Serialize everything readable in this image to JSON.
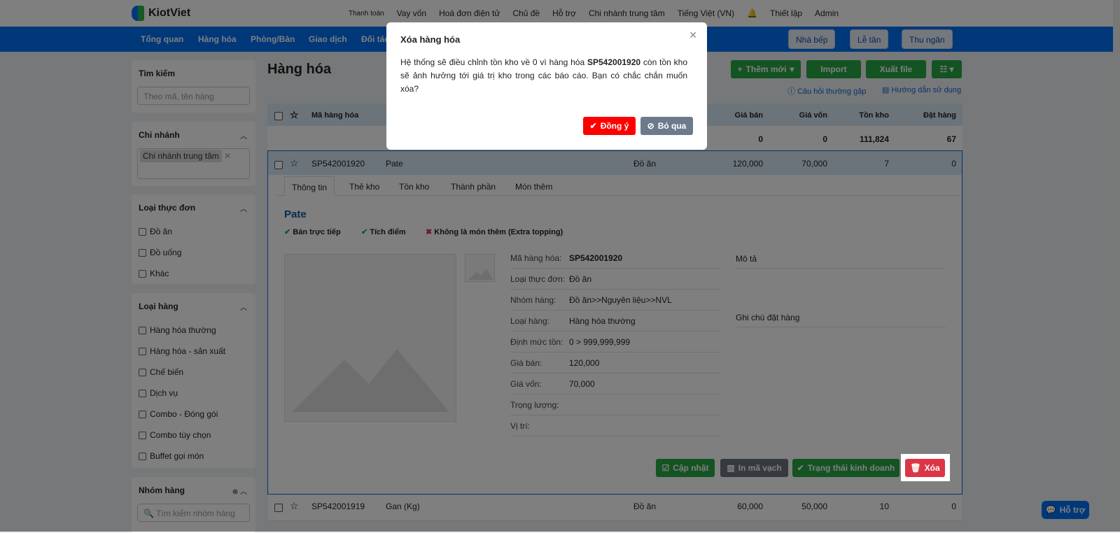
{
  "header": {
    "logo": "KiotViet",
    "links": [
      "Thanh toán",
      "Vay vốn",
      "Hoá đơn điện tử",
      "Chủ đề",
      "Hỗ trợ",
      "Chi nhánh trung tâm",
      "Tiếng Việt (VN)",
      "Thiết lập",
      "Admin"
    ]
  },
  "nav": {
    "items": [
      "Tổng quan",
      "Hàng hóa",
      "Phòng/Bàn",
      "Giao dịch",
      "Đối tác"
    ],
    "buttons": [
      "Nhà bếp",
      "Lễ tân",
      "Thu ngân"
    ]
  },
  "sidebar": {
    "search": {
      "title": "Tìm kiếm",
      "placeholder": "Theo mã, tên hàng"
    },
    "branch": {
      "title": "Chi nhánh",
      "tag": "Chi nhánh trung tâm"
    },
    "menu_type": {
      "title": "Loại thực đơn",
      "items": [
        "Đồ ăn",
        "Đồ uống",
        "Khác"
      ]
    },
    "goods_type": {
      "title": "Loại hàng",
      "items": [
        "Hàng hóa thường",
        "Hàng hóa - sản xuất",
        "Chế biến",
        "Dịch vụ",
        "Combo - Đóng gói",
        "Combo tùy chọn",
        "Buffet gọi món"
      ]
    },
    "group": {
      "title": "Nhóm hàng",
      "placeholder": "Tìm kiếm nhóm hàng"
    }
  },
  "main": {
    "title": "Hàng hóa",
    "actions": [
      "Thêm mới",
      "Import",
      "Xuất file"
    ],
    "help": [
      "Câu hỏi thường gặp",
      "Hướng dẫn sử dụng"
    ],
    "columns": [
      "Mã hàng hóa",
      "Giá bán",
      "Giá vốn",
      "Tồn kho",
      "Đặt hàng"
    ],
    "summary": [
      "0",
      "0",
      "111,824",
      "67"
    ],
    "rows": [
      {
        "code": "SP542001920",
        "name": "Pate",
        "type": "Đồ ăn",
        "price": "120,000",
        "cost": "70,000",
        "stock": "7",
        "order": "0"
      },
      {
        "code": "SP542001919",
        "name": "Gan (Kg)",
        "type": "Đồ ăn",
        "price": "60,000",
        "cost": "50,000",
        "stock": "10",
        "order": "0"
      }
    ],
    "detail": {
      "tabs": [
        "Thông tin",
        "Thẻ kho",
        "Tồn kho",
        "Thành phần",
        "Món thêm"
      ],
      "name": "Pate",
      "flags": [
        "Bán trực tiếp",
        "Tích điểm",
        "Không là món thêm (Extra topping)"
      ],
      "fields": [
        [
          "Mã hàng hóa:",
          "SP542001920"
        ],
        [
          "Loại thực đơn:",
          "Đồ ăn"
        ],
        [
          "Nhóm hàng:",
          "Đồ ăn>>Nguyên liệu>>NVL"
        ],
        [
          "Loại hàng:",
          "Hàng hóa thường"
        ],
        [
          "Định mức tồn:",
          "0  >  999,999,999"
        ],
        [
          "Giá bán:",
          "120,000"
        ],
        [
          "Giá vốn:",
          "70,000"
        ],
        [
          "Trọng lượng:",
          ""
        ],
        [
          "Vị trí:",
          ""
        ]
      ],
      "desc_label": "Mô tả",
      "note_label": "Ghi chú đặt hàng",
      "buttons": [
        "Cập nhật",
        "In mã vạch",
        "Trạng thái kinh doanh",
        "Xóa"
      ]
    }
  },
  "modal": {
    "title": "Xóa hàng hóa",
    "text_before": "Hệ thống sẽ điều chỉnh tồn kho về 0 vì hàng hóa ",
    "code": "SP542001920",
    "text_after": " còn tồn kho sẽ ảnh hưởng tới giá trị kho trong các báo cáo. Bạn có chắc chắn muốn xóa?",
    "confirm": "Đồng ý",
    "cancel": "Bỏ qua"
  },
  "chat": "Hỗ trợ"
}
